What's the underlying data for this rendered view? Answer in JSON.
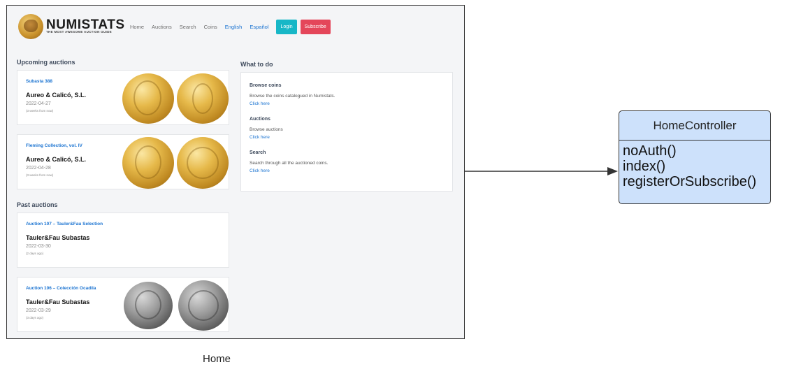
{
  "site": {
    "brand": "NUMISTATS",
    "tagline": "THE MOST AWESOME AUCTION GUIDE",
    "nav": [
      "Home",
      "Auctions",
      "Search",
      "Coins"
    ],
    "lang_en": "English",
    "lang_es": "Español",
    "login": "Login",
    "subscribe": "Subscribe",
    "upcoming_title": "Upcoming auctions",
    "past_title": "Past auctions",
    "todo_title": "What to do",
    "upcoming": [
      {
        "name": "Subasta 388",
        "house": "Aureo & Calicó, S.L.",
        "date": "2022-04-27",
        "relative": "(3 weeks from now)",
        "coin_style": "gold"
      },
      {
        "name": "Fleming Collection, vol. IV",
        "house": "Aureo & Calicó, S.L.",
        "date": "2022-04-28",
        "relative": "(3 weeks from now)",
        "coin_style": "gold"
      }
    ],
    "past": [
      {
        "name": "Auction 107 – Tauler&Fau Selection",
        "house": "Tauler&Fau Subastas",
        "date": "2022-03-30",
        "relative": "(2 days ago)"
      },
      {
        "name": "Auction 106 – Colección Ocadila",
        "house": "Tauler&Fau Subastas",
        "date": "2022-03-29",
        "relative": "(3 days ago)",
        "coin_style": "silver"
      }
    ],
    "todo": [
      {
        "title": "Browse coins",
        "desc": "Browse the coins catalogued in Numistats.",
        "link": "Click here"
      },
      {
        "title": "Auctions",
        "desc": "Browse auctions",
        "link": "Click here"
      },
      {
        "title": "Search",
        "desc": "Search through all the auctioned coins.",
        "link": "Click here"
      }
    ]
  },
  "caption": "Home",
  "class_box": {
    "name": "HomeController",
    "methods": [
      "noAuth()",
      "index()",
      "registerOrSubscribe()"
    ],
    "fill": "#cde1fb"
  }
}
